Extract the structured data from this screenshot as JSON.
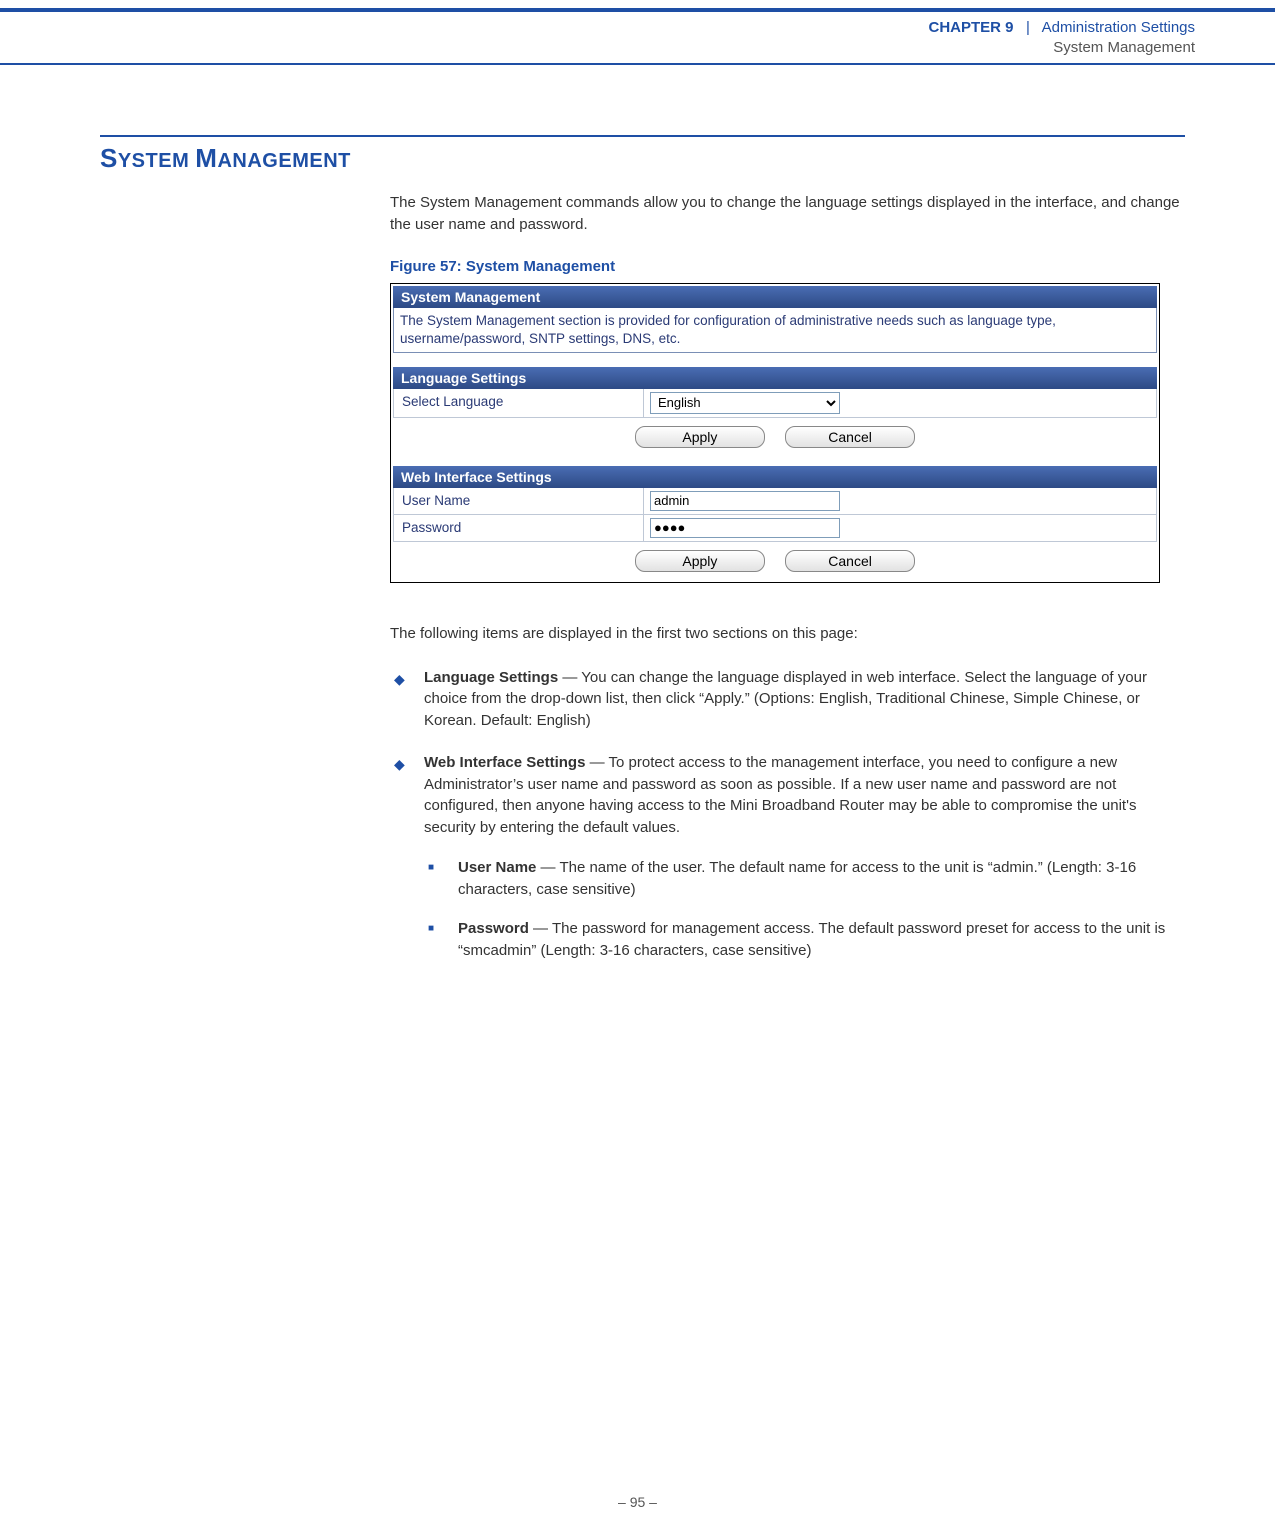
{
  "header": {
    "chapter_label": "CHAPTER 9",
    "separator": "|",
    "section": "Administration Settings",
    "subsection": "System Management"
  },
  "section_heading": "SYSTEM MANAGEMENT",
  "intro": "The System Management commands allow you to change the language settings displayed in the interface, and change the user name and password.",
  "figure_caption": "Figure 57:  System Management",
  "screenshot": {
    "panel_title": "System Management",
    "panel_desc": "The System Management section is provided for configuration of administrative needs such as language type, username/password, SNTP settings, DNS, etc.",
    "language_section": {
      "title": "Language Settings",
      "label": "Select Language",
      "selected": "English",
      "apply": "Apply",
      "cancel": "Cancel"
    },
    "web_section": {
      "title": "Web Interface Settings",
      "username_label": "User Name",
      "username_value": "admin",
      "password_label": "Password",
      "password_value": "●●●●",
      "apply": "Apply",
      "cancel": "Cancel"
    }
  },
  "after_text": "The following items are displayed in the first two sections on this page:",
  "bullets": {
    "lang": {
      "title": "Language Settings",
      "text": " — You can change the language displayed in web interface. Select the language of your choice from the drop-down list, then click “Apply.” (Options: English, Traditional Chinese, Simple Chinese, or Korean. Default: English)"
    },
    "web": {
      "title": "Web Interface Settings",
      "text": " — To protect access to the management interface, you need to configure a new Administrator’s user name and password as soon as possible. If a new user name and password are not configured, then anyone having access to the Mini Broadband Router may be able to compromise the unit's security by entering the default values.",
      "sub": {
        "username": {
          "title": "User Name",
          "text": " — The name of the user. The default name for access to the unit is “admin.” (Length: 3-16 characters, case sensitive)"
        },
        "password": {
          "title": "Password",
          "text": " — The password for management access. The default password preset for access to the unit is “smcadmin” (Length: 3-16 characters, case sensitive)"
        }
      }
    }
  },
  "footer": "–  95  –"
}
